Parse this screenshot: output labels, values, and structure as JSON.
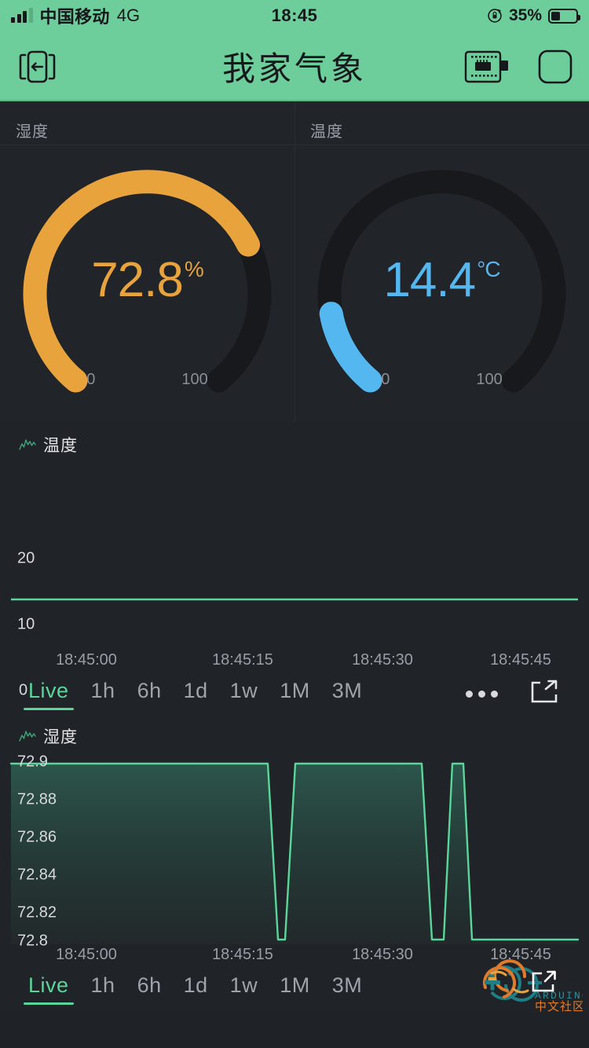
{
  "status_bar": {
    "carrier": "中国移动",
    "network": "4G",
    "time": "18:45",
    "battery_percent": "35%",
    "rotation_lock_icon": "rotation-lock-icon",
    "signal_icon": "signal-bars-icon",
    "battery_icon": "battery-icon"
  },
  "header": {
    "title": "我家气象",
    "left_icon": "logout-icon",
    "board_icon": "microcontroller-board-icon",
    "square_icon": "rounded-square-icon"
  },
  "gauges": [
    {
      "label": "湿度",
      "value": "72.8",
      "unit": "%",
      "min": "0",
      "max": "100",
      "color": "#E8A33D",
      "track_color": "#17191d",
      "percent": 72.8
    },
    {
      "label": "温度",
      "value": "14.4",
      "unit": "°C",
      "min": "0",
      "max": "100",
      "color": "#55B7F0",
      "track_color": "#17191d",
      "percent": 14.4
    }
  ],
  "charts": [
    {
      "legend": "温度",
      "legend_icon": "sparkline-icon",
      "line_color": "#5BD69A",
      "y_ticks": [
        "20",
        "10",
        "0"
      ],
      "x_ticks": [
        "18:45:00",
        "18:45:15",
        "18:45:30",
        "18:45:45"
      ],
      "ranges": [
        "Live",
        "1h",
        "6h",
        "1d",
        "1w",
        "1M",
        "3M"
      ],
      "active_range": "Live",
      "more_icon": "more-dots-icon",
      "expand_icon": "expand-icon",
      "has_toolbar_icons": true
    },
    {
      "legend": "湿度",
      "legend_icon": "sparkline-icon",
      "line_color": "#5BD69A",
      "y_ticks": [
        "72.9",
        "72.88",
        "72.86",
        "72.84",
        "72.82",
        "72.8"
      ],
      "x_ticks": [
        "18:45:00",
        "18:45:15",
        "18:45:30",
        "18:45:45"
      ],
      "ranges": [
        "Live",
        "1h",
        "6h",
        "1d",
        "1w",
        "1M",
        "3M"
      ],
      "active_range": "Live",
      "has_toolbar_icons": false
    }
  ],
  "watermark": {
    "brand": "ARDUINO",
    "community": "中文社区"
  },
  "chart_data": [
    {
      "type": "line",
      "title": "温度",
      "xlabel": "",
      "ylabel": "",
      "ylim": [
        0,
        24
      ],
      "yticks": [
        20,
        10,
        0
      ],
      "xticks": [
        "18:45:00",
        "18:45:15",
        "18:45:30",
        "18:45:45"
      ],
      "line_color": "#5BD69A",
      "grid": false,
      "legend": "温度",
      "series": [
        {
          "name": "温度",
          "x": [
            "18:44:55",
            "18:45:00",
            "18:45:15",
            "18:45:30",
            "18:45:45",
            "18:45:52"
          ],
          "values": [
            14.4,
            14.4,
            14.4,
            14.4,
            14.4,
            14.4
          ]
        }
      ]
    },
    {
      "type": "area",
      "title": "湿度",
      "xlabel": "",
      "ylabel": "",
      "ylim": [
        72.8,
        72.9
      ],
      "yticks": [
        72.9,
        72.88,
        72.86,
        72.84,
        72.82,
        72.8
      ],
      "xticks": [
        "18:45:00",
        "18:45:15",
        "18:45:30",
        "18:45:45"
      ],
      "line_color": "#5BD69A",
      "grid": false,
      "legend": "湿度",
      "series": [
        {
          "name": "湿度",
          "note": "square-wave between 72.8 and 72.9",
          "points": [
            [
              0.0,
              72.9
            ],
            [
              0.455,
              72.9
            ],
            [
              0.472,
              72.8
            ],
            [
              0.492,
              72.8
            ],
            [
              0.512,
              72.9
            ],
            [
              0.727,
              72.9
            ],
            [
              0.745,
              72.8
            ],
            [
              0.765,
              72.8
            ],
            [
              0.782,
              72.9
            ],
            [
              0.8,
              72.9
            ],
            [
              0.818,
              72.8
            ],
            [
              1.0,
              72.8
            ]
          ]
        }
      ]
    }
  ]
}
